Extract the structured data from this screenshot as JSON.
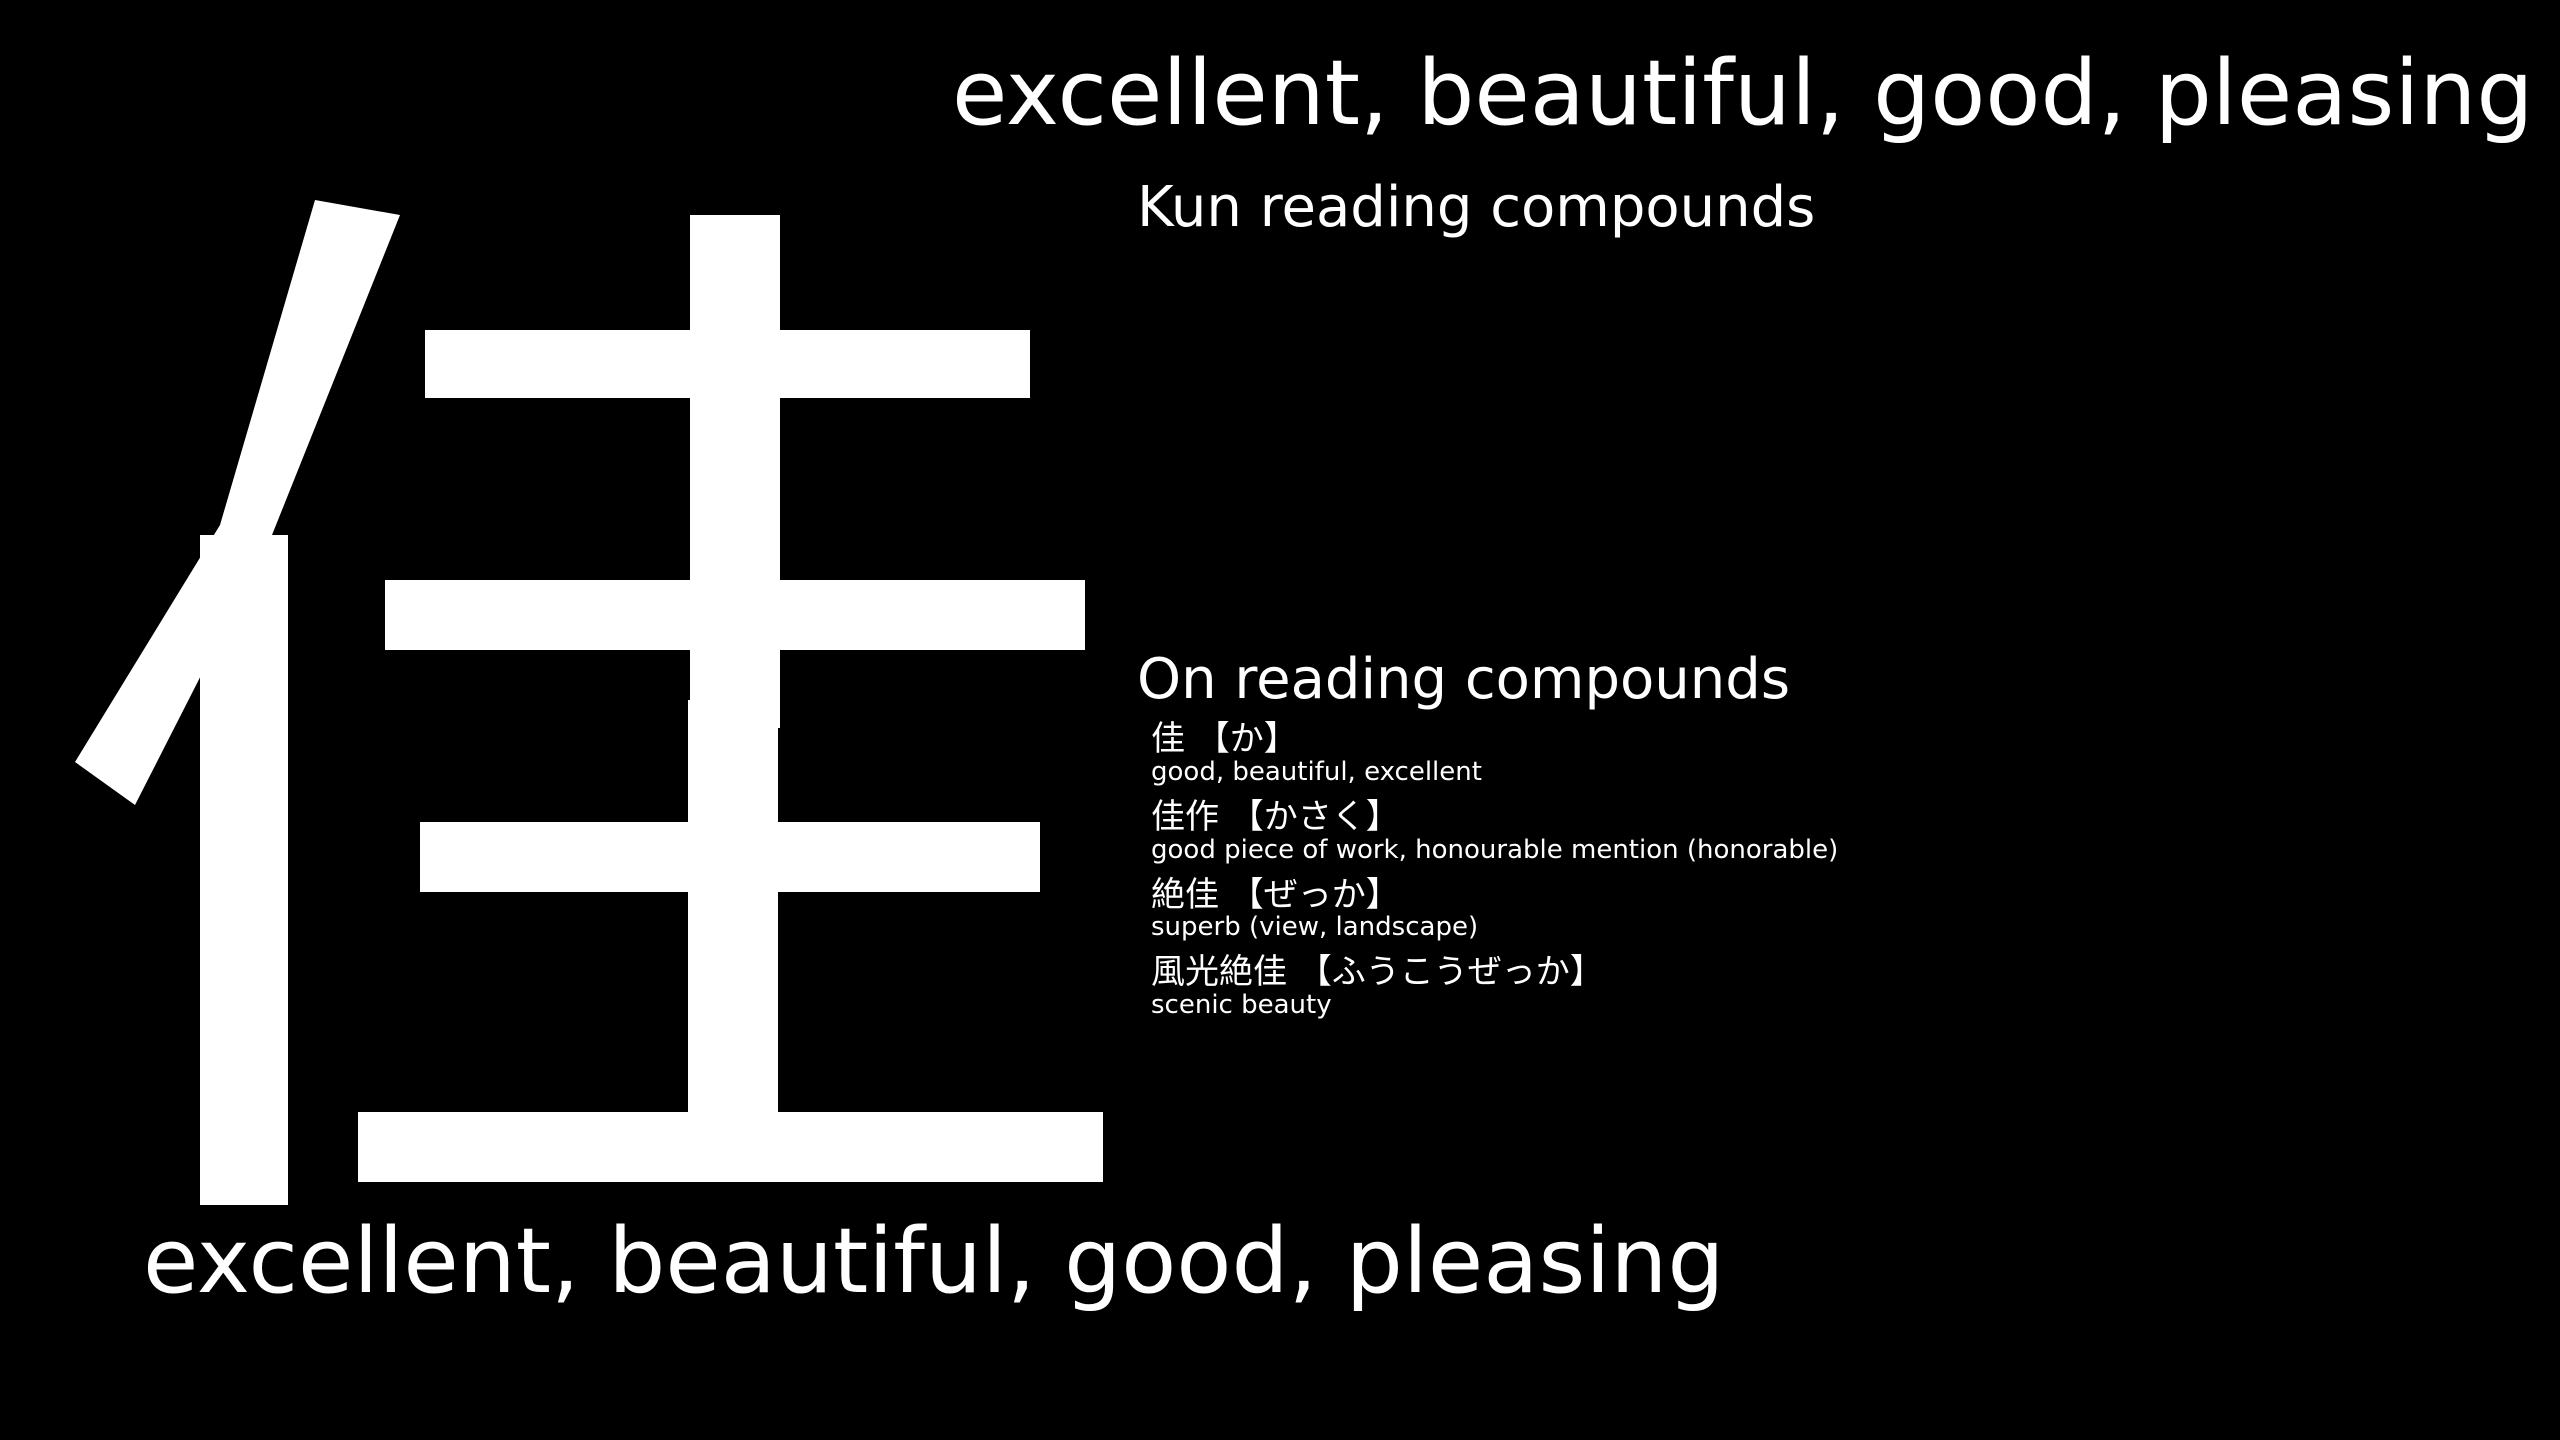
{
  "kanji": "佳",
  "meaning": "excellent, beautiful, good, pleasing",
  "kun_heading": "Kun reading compounds",
  "on_heading": "On reading compounds",
  "on_compounds": [
    {
      "word": "佳 【か】",
      "gloss": "good, beautiful, excellent"
    },
    {
      "word": "佳作 【かさく】",
      "gloss": "good piece of work, honourable mention (honorable)"
    },
    {
      "word": "絶佳 【ぜっか】",
      "gloss": "superb (view, landscape)"
    },
    {
      "word": "風光絶佳 【ふうこうぜっか】",
      "gloss": "scenic beauty"
    }
  ],
  "colors": {
    "background": "#000000",
    "text": "#ffffff"
  }
}
